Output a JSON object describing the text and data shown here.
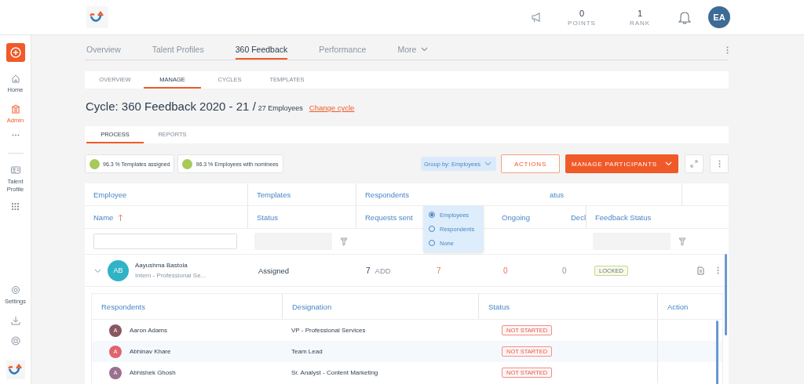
{
  "header": {
    "stats": [
      {
        "value": "0",
        "label": "POINTS"
      },
      {
        "value": "1",
        "label": "RANK"
      }
    ],
    "avatar": "EA"
  },
  "sidebar": {
    "items": [
      {
        "kind": "home",
        "label": "Home",
        "selected": false
      },
      {
        "kind": "admin",
        "label": "Admin",
        "selected": true
      },
      {
        "kind": "more",
        "selected": false
      },
      {
        "kind": "divider"
      },
      {
        "kind": "profile",
        "label": "Talent Profile",
        "selected": false
      },
      {
        "kind": "apps",
        "selected": false
      },
      {
        "kind": "spacer"
      },
      {
        "kind": "settings",
        "label": "Settings",
        "selected": false
      },
      {
        "kind": "download",
        "selected": false
      },
      {
        "kind": "help",
        "selected": false
      }
    ]
  },
  "main_tabs": [
    {
      "label": "Overview",
      "selected": false,
      "dropdown": false
    },
    {
      "label": "Talent Profiles",
      "selected": false,
      "dropdown": false
    },
    {
      "label": "360 Feedback",
      "selected": true,
      "dropdown": false
    },
    {
      "label": "Performance",
      "selected": false,
      "dropdown": false
    },
    {
      "label": "More",
      "selected": false,
      "dropdown": true
    }
  ],
  "sub_tabs": [
    {
      "label": "OVERVIEW",
      "selected": false
    },
    {
      "label": "MANAGE",
      "selected": true
    },
    {
      "label": "CYCLES",
      "selected": false
    },
    {
      "label": "TEMPLATES",
      "selected": false
    }
  ],
  "title": {
    "cycle": "Cycle: 360 Feedback 2020 - 21 /",
    "count": "27 Employees",
    "link": "Change cycle"
  },
  "process_tabs": [
    {
      "label": "PROCESS",
      "selected": true
    },
    {
      "label": "REPORTS",
      "selected": false
    }
  ],
  "chips": [
    {
      "text": "96.3 % Templates assigned",
      "color": "#a5c95a"
    },
    {
      "text": "96.3 % Employees with nominees",
      "color": "#a5c95a"
    }
  ],
  "toolbar": {
    "group_by": "Group by: Employees",
    "actions": "ACTIONS",
    "manage": "MANAGE PARTICIPANTS"
  },
  "group_menu": [
    {
      "label": "Employees",
      "selected": true
    },
    {
      "label": "Respondents",
      "selected": false
    },
    {
      "label": "None",
      "selected": false
    }
  ],
  "table": {
    "group_headers": [
      "Employee",
      "Templates",
      "Respondents",
      "atus"
    ],
    "columns": [
      "Name",
      "Status",
      "Requests sent",
      "Ongoing",
      "Decl",
      "Feedback Status"
    ],
    "rows": [
      {
        "expanded": true,
        "initials": "AB",
        "name": "Aayushma Bastola",
        "designation": "Intern - Professional Se...",
        "template_status": "Assigned",
        "requests_sent": "7",
        "add": "ADD",
        "column_4": "7",
        "ongoing": "0",
        "declined": "0",
        "feedback_status": "LOCKED"
      }
    ]
  },
  "respondents": {
    "columns": [
      "Respondents",
      "Designation",
      "Status",
      "Action"
    ],
    "rows": [
      {
        "initial": "A",
        "name": "Aaron Adams",
        "designation": "VP - Professional Services",
        "status": "NOT STARTED",
        "color": "#8a5660"
      },
      {
        "initial": "A",
        "name": "Abhinav Khare",
        "designation": "Team Lead",
        "status": "NOT STARTED",
        "color": "#e0646e"
      },
      {
        "initial": "A",
        "name": "Abhishek Ghosh",
        "designation": "Sr. Analyst - Content Marketing",
        "status": "NOT STARTED",
        "color": "#9c7090"
      }
    ]
  }
}
